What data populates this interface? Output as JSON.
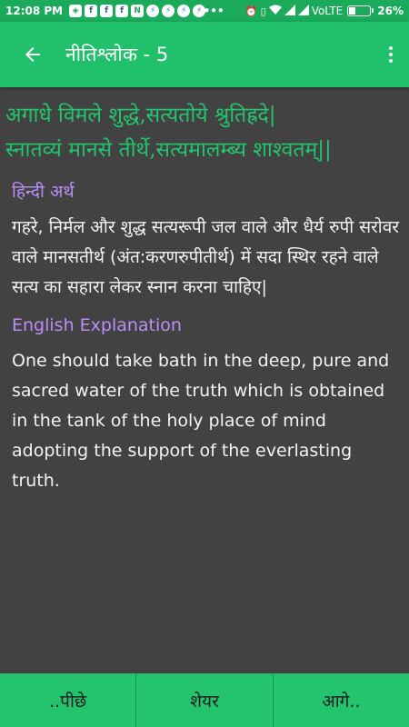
{
  "status_bar": {
    "time": "12:08 PM",
    "network": "VoLTE",
    "battery_percent": "26%",
    "battery_level": 0.26,
    "left_icons": [
      "shield-notification-icon",
      "facebook-icon",
      "facebook-icon",
      "facebook-icon",
      "news-icon",
      "messenger-icon",
      "messenger-icon",
      "messenger-icon",
      "messenger-icon",
      "more-dots-icon"
    ],
    "right_icons": [
      "alarm-icon",
      "vibrate-icon",
      "wifi-icon",
      "signal-icon",
      "signal-icon"
    ]
  },
  "app_bar": {
    "title": "नीतिश्लोक - 5"
  },
  "shloka": {
    "line1": "अगाधे विमले शुद्धे,सत्यतोये श्रुतिह्रदे|",
    "line2": "स्नातव्यं मानसे तीर्थे,सत्यमालम्ब्य शाश्वतम्||"
  },
  "hindi": {
    "heading": "हिन्दी अर्थ",
    "text": "गहरे, निर्मल और शुद्ध सत्यरूपी जल वाले और धैर्य रुपी सरोवर वाले मानसतीर्थ (अंत:करणरुपीतीर्थ) में सदा स्थिर रहने वाले सत्य का सहारा लेकर स्नान करना चाहिए|"
  },
  "english": {
    "heading": "English Explanation",
    "text": "One should take bath in the deep, pure and sacred water of the truth which is obtained in the tank of the holy place of mind adopting the support of the everlasting truth."
  },
  "bottom_nav": {
    "prev_label": "..पीछे",
    "share_label": "शेयर",
    "next_label": "आगे.."
  },
  "colors": {
    "status_bar": "#1ba95a",
    "app_bar": "#21c06a",
    "background": "#424242",
    "shloka_text": "#24c46e",
    "heading_text": "#b98ef6",
    "bottom_bar": "#24c46e"
  }
}
